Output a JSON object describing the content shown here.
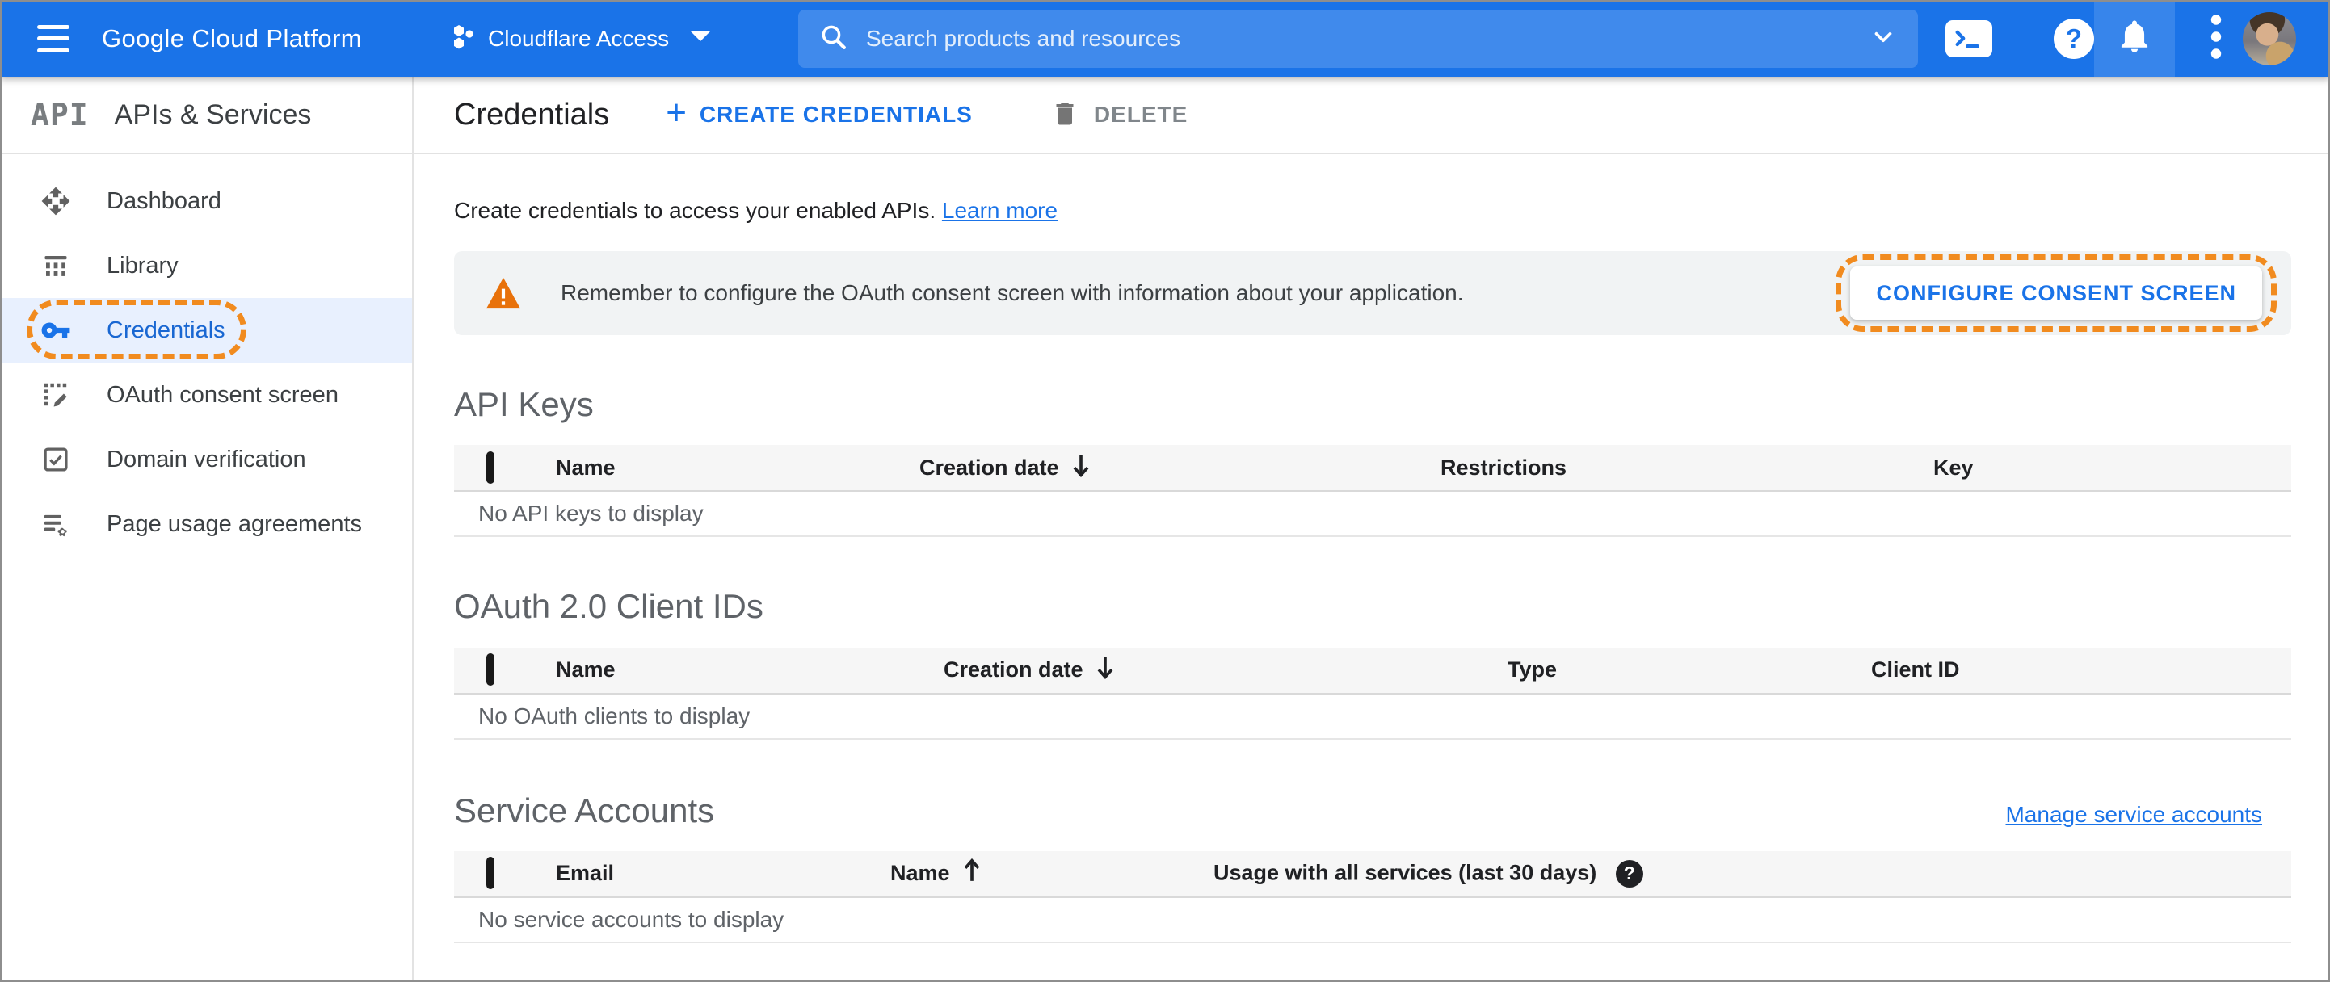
{
  "topbar": {
    "brand": "Google Cloud Platform",
    "project": "Cloudflare Access",
    "search_placeholder": "Search products and resources"
  },
  "sidebar": {
    "logo": "API",
    "title": "APIs & Services",
    "items": [
      {
        "label": "Dashboard"
      },
      {
        "label": "Library"
      },
      {
        "label": "Credentials"
      },
      {
        "label": "OAuth consent screen"
      },
      {
        "label": "Domain verification"
      },
      {
        "label": "Page usage agreements"
      }
    ],
    "selected_item": "Credentials"
  },
  "page": {
    "title": "Credentials",
    "create_button": "CREATE CREDENTIALS",
    "delete_button": "DELETE",
    "intro": "Create credentials to access your enabled APIs.",
    "learn_more": "Learn more",
    "banner": {
      "message": "Remember to configure the OAuth consent screen with information about your application.",
      "action": "CONFIGURE CONSENT SCREEN"
    }
  },
  "tables": {
    "api_keys": {
      "title": "API Keys",
      "columns": [
        "Name",
        "Creation date",
        "Restrictions",
        "Key"
      ],
      "sort": "Creation date descending",
      "empty_message": "No API keys to display"
    },
    "oauth_clients": {
      "title": "OAuth 2.0 Client IDs",
      "columns": [
        "Name",
        "Creation date",
        "Type",
        "Client ID"
      ],
      "sort": "Creation date descending",
      "empty_message": "No OAuth clients to display"
    },
    "service_accounts": {
      "title": "Service Accounts",
      "manage_link": "Manage service accounts",
      "columns": [
        "Email",
        "Name",
        "Usage with all services (last 30 days)"
      ],
      "sort": "Name ascending",
      "empty_message": "No service accounts to display"
    }
  },
  "icons": {
    "plus": "+",
    "help": "?",
    "sort_desc": "down-arrow",
    "sort_asc": "up-arrow"
  },
  "colors": {
    "topbar_blue": "#1a73e8",
    "link_blue": "#1a73e8",
    "selected_item_text": "#1967d2",
    "selected_item_bg": "#e8f0fe",
    "annotation_orange": "#f18b1f",
    "warning_orange": "#e8710a",
    "banner_bg": "#f1f3f4"
  }
}
